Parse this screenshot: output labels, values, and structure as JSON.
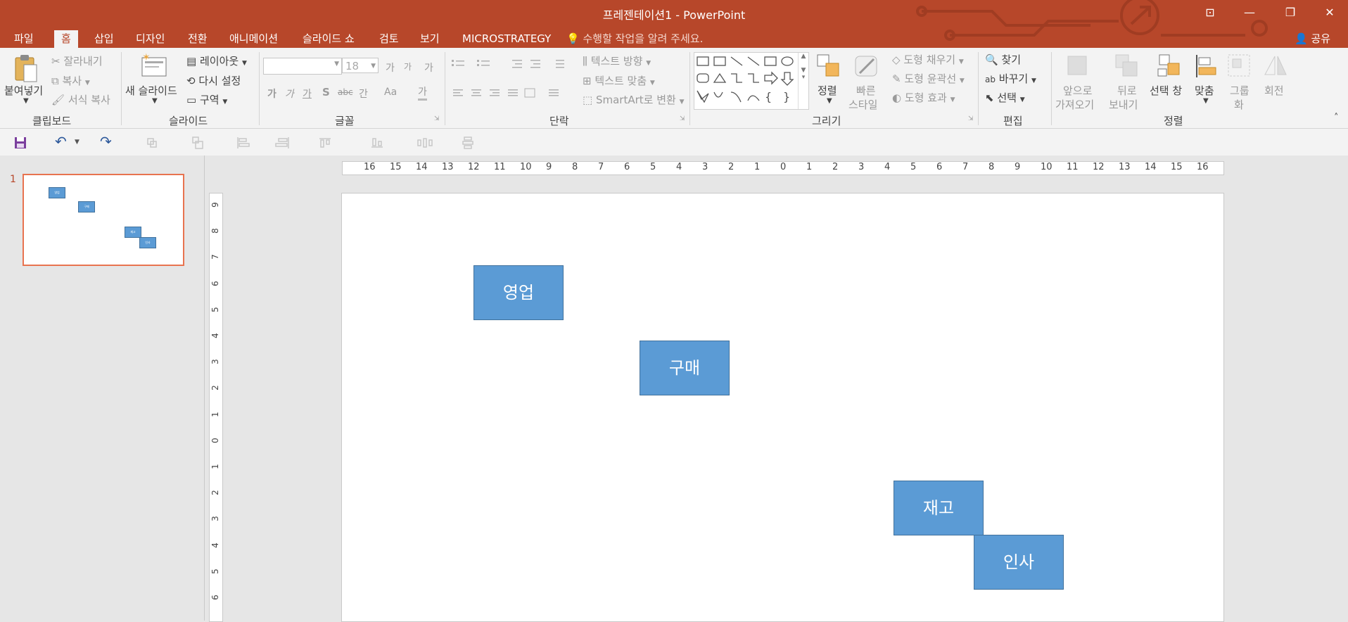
{
  "title": "프레젠테이션1 - PowerPoint",
  "window_buttons": [
    "⊡",
    "—",
    "❐",
    "✕"
  ],
  "tabs": [
    {
      "label": "파일",
      "active": false
    },
    {
      "label": "홈",
      "active": true
    },
    {
      "label": "삽입",
      "active": false
    },
    {
      "label": "디자인",
      "active": false
    },
    {
      "label": "전환",
      "active": false
    },
    {
      "label": "애니메이션",
      "active": false
    },
    {
      "label": "슬라이드 쇼",
      "active": false
    },
    {
      "label": "검토",
      "active": false
    },
    {
      "label": "보기",
      "active": false
    },
    {
      "label": "MICROSTRATEGY",
      "active": false
    }
  ],
  "tell_me": "수행할 작업을 알려 주세요.",
  "share": "공유",
  "ribbon": {
    "clipboard": {
      "paste": "붙여넣기",
      "cut": "잘라내기",
      "copy": "복사",
      "format_painter": "서식 복사",
      "label": "클립보드"
    },
    "slides": {
      "new_slide": "새 슬라이드",
      "layout": "레이아웃",
      "reset": "다시 설정",
      "section": "구역",
      "label": "슬라이드"
    },
    "font": {
      "font_name": "",
      "font_size": "18",
      "label": "글꼴",
      "increase": "가",
      "decrease": "가",
      "clear": "가",
      "bold": "가",
      "italic": "가",
      "underline": "가",
      "shadow": "S",
      "strike": "abc",
      "spacing": "간",
      "case": "Aa",
      "color": "가"
    },
    "paragraph": {
      "text_direction": "텍스트 방향",
      "align_text": "텍스트 맞춤",
      "smartart": "SmartArt로 변환",
      "label": "단락"
    },
    "drawing": {
      "arrange": "정렬",
      "quick_styles": "빠른 스타일",
      "quick_styles_line1": "빠른",
      "quick_styles_line2": "스타일",
      "shape_fill": "도형 채우기",
      "shape_outline": "도형 윤곽선",
      "shape_effects": "도형 효과",
      "label": "그리기"
    },
    "editing": {
      "find": "찾기",
      "replace": "바꾸기",
      "select": "선택",
      "label": "편집"
    },
    "arrange": {
      "bring_forward_1": "앞으로",
      "bring_forward_2": "가져오기",
      "send_backward_1": "뒤로",
      "send_backward_2": "보내기",
      "selection_pane": "선택 창",
      "align": "맞춤",
      "group_1": "그룹",
      "group_2": "화",
      "rotate": "회전",
      "label": "정렬"
    }
  },
  "slide_number": "1",
  "ruler": {
    "h_ticks": [
      "16",
      "15",
      "14",
      "13",
      "12",
      "11",
      "10",
      "9",
      "8",
      "7",
      "6",
      "5",
      "4",
      "3",
      "2",
      "1",
      "0",
      "1",
      "2",
      "3",
      "4",
      "5",
      "6",
      "7",
      "8",
      "9",
      "10",
      "11",
      "12",
      "13",
      "14",
      "15",
      "16"
    ],
    "v_ticks": [
      "9",
      "8",
      "7",
      "6",
      "5",
      "4",
      "3",
      "2",
      "1",
      "0",
      "1",
      "2",
      "3",
      "4",
      "5",
      "6"
    ]
  },
  "shapes": [
    {
      "label": "영업"
    },
    {
      "label": "구매"
    },
    {
      "label": "재고"
    },
    {
      "label": "인사"
    }
  ],
  "colors": {
    "accent": "#b7472a",
    "shape_fill": "#5b9bd5",
    "shape_border": "#41719c",
    "selection": "#e8734f"
  }
}
